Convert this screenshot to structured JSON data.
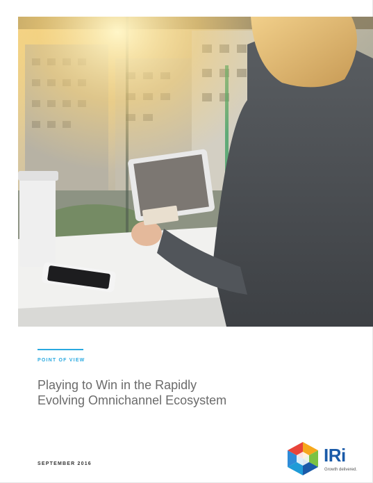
{
  "cover": {
    "kicker": "POINT OF VIEW",
    "title_line1": "Playing to Win in the Rapidly",
    "title_line2": "Evolving Omnichannel Ecosystem",
    "date": "SEPTEMBER 2016"
  },
  "logo": {
    "wordmark": "IRi",
    "tagline": "Growth delivered.",
    "icon": "iri-hexagon-logo-icon"
  },
  "hero": {
    "icon": "woman-with-tablet-photo"
  },
  "colors": {
    "accent": "#29a9e0",
    "title_text": "#6b6b6b",
    "brand_blue": "#1a5aa8"
  }
}
